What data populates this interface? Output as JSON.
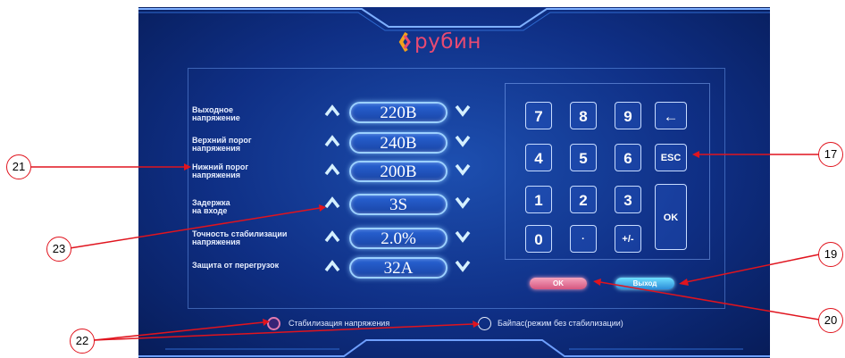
{
  "logo": {
    "text": "рубин"
  },
  "settings": [
    {
      "label_line1": "Выходное",
      "label_line2": "напряжение",
      "value": "220B"
    },
    {
      "label_line1": "Верхний порог",
      "label_line2": "напряжения",
      "value": "240B"
    },
    {
      "label_line1": "Нижний порог",
      "label_line2": "напряжения",
      "value": "200B"
    },
    {
      "label_line1": "Задержка",
      "label_line2": "на входе",
      "value": "3S"
    },
    {
      "label_line1": "Точность стабилизации",
      "label_line2": "напряжения",
      "value": "2.0%"
    },
    {
      "label_line1": "Защита от перегрузок",
      "label_line2": "",
      "value": "32A"
    }
  ],
  "keypad": {
    "keys": [
      "7",
      "8",
      "9",
      "←",
      "4",
      "5",
      "6",
      "ESC",
      "1",
      "2",
      "3",
      "OK",
      "0",
      "·",
      "+/-"
    ]
  },
  "buttons": {
    "ok": "OK",
    "exit": "Выход"
  },
  "modes": {
    "stabilization": "Стабилизация напряжения",
    "bypass": "Байпас(режим без стабилизации)"
  },
  "callouts": [
    "21",
    "23",
    "17",
    "19",
    "20",
    "22"
  ],
  "colors": {
    "accent_pink": "#e84a72",
    "screen_blue": "#0f2f85",
    "callout_red": "#e0141e"
  }
}
